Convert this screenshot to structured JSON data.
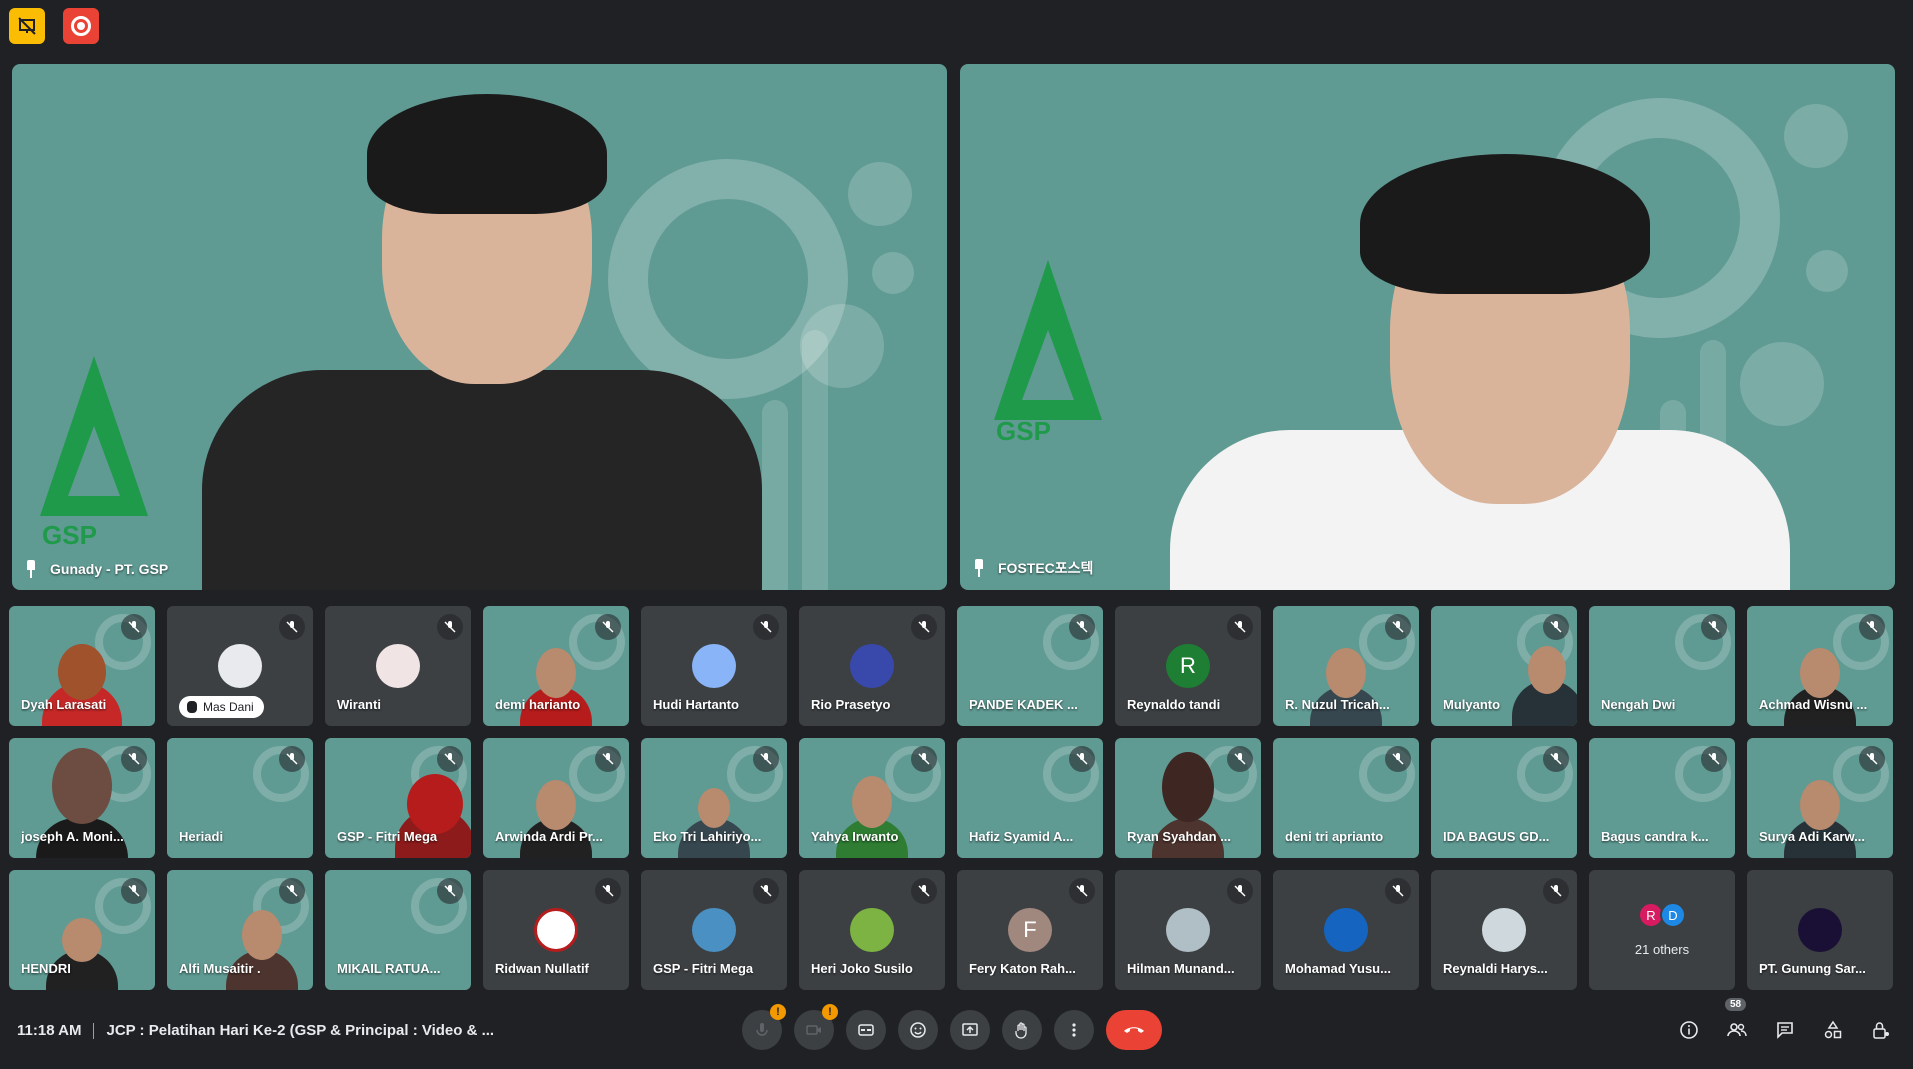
{
  "top_indicators": {
    "presenting_icon": "presentation-off-icon",
    "recording_icon": "record-icon",
    "accent_yellow": "#fbbc04",
    "accent_red": "#ea4335"
  },
  "pinned": [
    {
      "name": "Gunady - PT. GSP"
    },
    {
      "name": "FOSTEC포스텍"
    }
  ],
  "participants": [
    "Dyah Larasati",
    "Mas Dani",
    "Wiranti",
    "demi harianto",
    "Hudi Hartanto",
    "Rio Prasetyo",
    "PANDE KADEK ...",
    "Reynaldo tandi",
    "R. Nuzul Tricah...",
    "Mulyanto",
    "Nengah Dwi",
    "Achmad Wisnu ...",
    "joseph A. Moni...",
    "Heriadi",
    "GSP - Fitri Mega",
    "Arwinda Ardi Pr...",
    "Eko Tri Lahiriyo...",
    "Yahya Irwanto",
    "Hafiz Syamid A...",
    "Ryan Syahdan ...",
    "deni tri aprianto",
    "IDA BAGUS GD...",
    "Bagus candra k...",
    "Surya Adi Karw...",
    "HENDRI",
    "Alfi Musaitir .",
    "MIKAIL RATUA...",
    "Ridwan Nullatif",
    "GSP - Fitri Mega",
    "Heri Joko Susilo",
    "Fery Katon Rah...",
    "Hilman Munand...",
    "Mohamad Yusu...",
    "Reynaldi Harys...",
    "21 others",
    "PT. Gunung Sar..."
  ],
  "avatar_letters": {
    "reynaldo": "R",
    "fery": "F",
    "others_a": "R",
    "others_b": "D"
  },
  "bottom": {
    "time": "11:18 AM",
    "title": "JCP : Pelatihan Hari Ke-2 (GSP & Principal : Video & ...",
    "warn_mark": "!",
    "people_count": "58",
    "end_color": "#ea4335"
  }
}
